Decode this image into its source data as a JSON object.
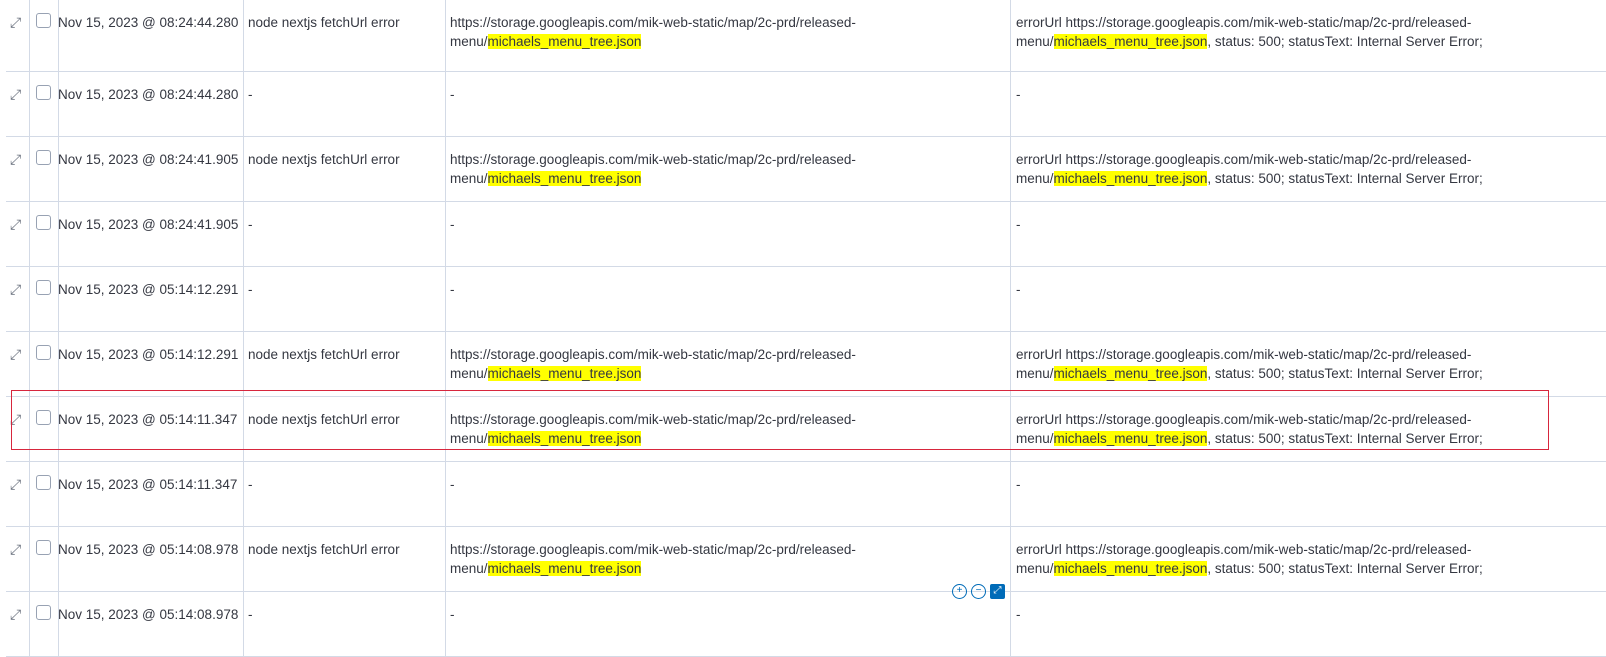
{
  "highlight_term": "michaels_menu_tree.json",
  "url_prefix": "https://storage.googleapis.com/mik-web-static/map/2c-prd/released-menu/",
  "rows": [
    {
      "ts": "Nov 15, 2023 @ 08:24:44.280",
      "message": "node nextjs fetchUrl error",
      "url": "https://storage.googleapis.com/mik-web-static/map/2c-prd/released-menu/michaels_menu_tree.json",
      "error": "errorUrl https://storage.googleapis.com/mik-web-static/map/2c-prd/released-menu/michaels_menu_tree.json, status: 500; statusText: Internal Server Error;"
    },
    {
      "ts": "Nov 15, 2023 @ 08:24:44.280",
      "message": "-",
      "url": "-",
      "error": "-"
    },
    {
      "ts": "Nov 15, 2023 @ 08:24:41.905",
      "message": "node nextjs fetchUrl error",
      "url": "https://storage.googleapis.com/mik-web-static/map/2c-prd/released-menu/michaels_menu_tree.json",
      "error": "errorUrl https://storage.googleapis.com/mik-web-static/map/2c-prd/released-menu/michaels_menu_tree.json, status: 500; statusText: Internal Server Error;"
    },
    {
      "ts": "Nov 15, 2023 @ 08:24:41.905",
      "message": "-",
      "url": "-",
      "error": "-"
    },
    {
      "ts": "Nov 15, 2023 @ 05:14:12.291",
      "message": "-",
      "url": "-",
      "error": "-"
    },
    {
      "ts": "Nov 15, 2023 @ 05:14:12.291",
      "message": "node nextjs fetchUrl error",
      "url": "https://storage.googleapis.com/mik-web-static/map/2c-prd/released-menu/michaels_menu_tree.json",
      "error": "errorUrl https://storage.googleapis.com/mik-web-static/map/2c-prd/released-menu/michaels_menu_tree.json, status: 500; statusText: Internal Server Error;"
    },
    {
      "ts": "Nov 15, 2023 @ 05:14:11.347",
      "message": "node nextjs fetchUrl error",
      "url": "https://storage.googleapis.com/mik-web-static/map/2c-prd/released-menu/michaels_menu_tree.json",
      "error": "errorUrl https://storage.googleapis.com/mik-web-static/map/2c-prd/released-menu/michaels_menu_tree.json, status: 500; statusText: Internal Server Error;"
    },
    {
      "ts": "Nov 15, 2023 @ 05:14:11.347",
      "message": "-",
      "url": "-",
      "error": "-"
    },
    {
      "ts": "Nov 15, 2023 @ 05:14:08.978",
      "message": "node nextjs fetchUrl error",
      "url": "https://storage.googleapis.com/mik-web-static/map/2c-prd/released-menu/michaels_menu_tree.json",
      "error": "errorUrl https://storage.googleapis.com/mik-web-static/map/2c-prd/released-menu/michaels_menu_tree.json, status: 500; statusText: Internal Server Error;"
    },
    {
      "ts": "Nov 15, 2023 @ 05:14:08.978",
      "message": "-",
      "url": "-",
      "error": "-"
    }
  ],
  "cell_actions": {
    "filter_in_icon": "plus-circle-icon",
    "filter_out_icon": "minus-circle-icon",
    "expand_icon": "expand-square-icon"
  },
  "colors": {
    "highlight": "#ffff00",
    "selection_outline": "#d7263d",
    "action_blue": "#006bb8"
  }
}
